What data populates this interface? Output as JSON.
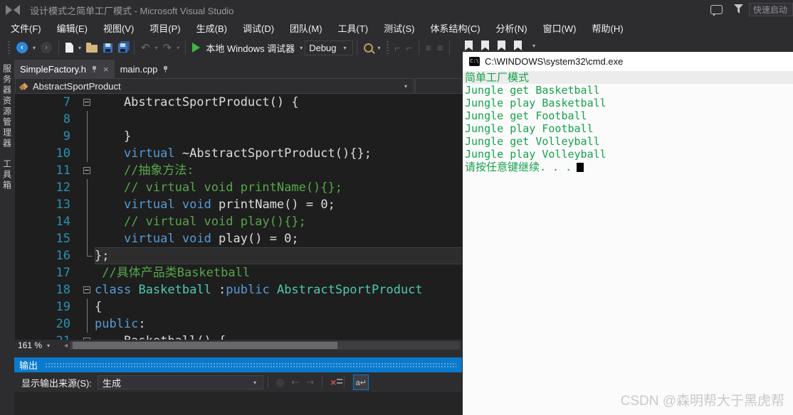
{
  "window": {
    "title": "设计模式之简单工厂模式 - Microsoft Visual Studio",
    "quick_launch": "快速启动"
  },
  "menu": {
    "items": [
      "文件(F)",
      "编辑(E)",
      "视图(V)",
      "项目(P)",
      "生成(B)",
      "调试(D)",
      "团队(M)",
      "工具(T)",
      "测试(S)",
      "体系结构(C)",
      "分析(N)",
      "窗口(W)",
      "帮助(H)"
    ]
  },
  "toolbar": {
    "debug_target": "本地 Windows 调试器",
    "configuration": "Debug"
  },
  "side_strip": {
    "items": [
      "服务器资源管理器",
      "工具箱"
    ]
  },
  "tabs": [
    {
      "label": "SimpleFactory.h",
      "active": true,
      "closable": true
    },
    {
      "label": "main.cpp",
      "active": false,
      "closable": false
    }
  ],
  "breadcrumb": {
    "type_name": "AbstractSportProduct"
  },
  "editor": {
    "zoom": "161 %",
    "lines": [
      {
        "n": "7",
        "fold": "box",
        "hl": false,
        "seg": [
          [
            "pl",
            "    AbstractSportProduct() {"
          ]
        ]
      },
      {
        "n": "8",
        "fold": "line",
        "hl": false,
        "seg": []
      },
      {
        "n": "9",
        "fold": "line",
        "hl": false,
        "seg": [
          [
            "pl",
            "    }"
          ]
        ]
      },
      {
        "n": "10",
        "fold": "line",
        "hl": false,
        "seg": [
          [
            "pl",
            "    "
          ],
          [
            "kw",
            "virtual"
          ],
          [
            "pl",
            " ~AbstractSportProduct(){};"
          ]
        ]
      },
      {
        "n": "11",
        "fold": "box",
        "hl": false,
        "seg": [
          [
            "pl",
            "    "
          ],
          [
            "cm",
            "//抽象方法:"
          ]
        ]
      },
      {
        "n": "12",
        "fold": "line",
        "hl": false,
        "seg": [
          [
            "pl",
            "    "
          ],
          [
            "cm",
            "// virtual void printName(){};"
          ]
        ]
      },
      {
        "n": "13",
        "fold": "line",
        "hl": false,
        "seg": [
          [
            "pl",
            "    "
          ],
          [
            "kw",
            "virtual"
          ],
          [
            "pl",
            " "
          ],
          [
            "kw",
            "void"
          ],
          [
            "pl",
            " printName() = 0;"
          ]
        ]
      },
      {
        "n": "14",
        "fold": "line",
        "hl": false,
        "seg": [
          [
            "pl",
            "    "
          ],
          [
            "cm",
            "// virtual void play(){};"
          ]
        ]
      },
      {
        "n": "15",
        "fold": "line",
        "hl": false,
        "seg": [
          [
            "pl",
            "    "
          ],
          [
            "kw",
            "virtual"
          ],
          [
            "pl",
            " "
          ],
          [
            "kw",
            "void"
          ],
          [
            "pl",
            " play() = 0;"
          ]
        ]
      },
      {
        "n": "16",
        "fold": "foot",
        "hl": true,
        "seg": [
          [
            "pl",
            "};"
          ]
        ]
      },
      {
        "n": "17",
        "fold": "none",
        "hl": false,
        "seg": [
          [
            "pl",
            " "
          ],
          [
            "cm",
            "//具体产品类Basketball"
          ]
        ]
      },
      {
        "n": "18",
        "fold": "box",
        "hl": false,
        "seg": [
          [
            "kw",
            "class"
          ],
          [
            "pl",
            " "
          ],
          [
            "cls",
            "Basketball"
          ],
          [
            "pl",
            " :"
          ],
          [
            "kw",
            "public"
          ],
          [
            "pl",
            " "
          ],
          [
            "cls",
            "AbstractSportProduct"
          ]
        ]
      },
      {
        "n": "19",
        "fold": "line",
        "hl": false,
        "seg": [
          [
            "pl",
            "{"
          ]
        ]
      },
      {
        "n": "20",
        "fold": "line",
        "hl": false,
        "seg": [
          [
            "kw",
            "public"
          ],
          [
            "pl",
            ":"
          ]
        ]
      },
      {
        "n": "21",
        "fold": "box",
        "hl": false,
        "seg": [
          [
            "pl",
            "    Basketball() {"
          ]
        ]
      }
    ]
  },
  "output": {
    "title": "输出",
    "source_label": "显示输出来源(S):",
    "source_value": "生成"
  },
  "console": {
    "title": "C:\\WINDOWS\\system32\\cmd.exe",
    "icon_label": "C:\\",
    "lines": [
      "简单工厂模式",
      "Jungle get Basketball",
      "Jungle play Basketball",
      "Jungle get Football",
      "Jungle play Football",
      "Jungle get Volleyball",
      "Jungle play Volleyball"
    ],
    "prompt": "请按任意键继续. . ."
  },
  "watermark": {
    "text": "CSDN @森明帮大于黑虎帮"
  },
  "colors": {
    "accent_blue": "#0a7acc",
    "editor_bg": "#1e1e1e",
    "chrome_bg": "#2d2d30",
    "keyword": "#569cd6",
    "comment": "#57a64a",
    "class_name": "#4ec9b0",
    "line_number": "#2b91af",
    "console_green": "#16a24c"
  }
}
